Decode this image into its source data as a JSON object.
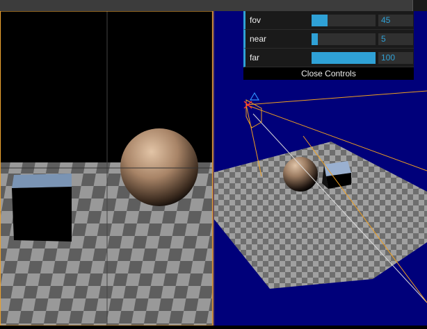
{
  "controls": {
    "sliders": [
      {
        "label": "fov",
        "value": "45",
        "fraction": 0.25
      },
      {
        "label": "near",
        "value": "5",
        "fraction": 0.1
      },
      {
        "label": "far",
        "value": "100",
        "fraction": 1.0
      }
    ],
    "close_label": "Close Controls",
    "accent_color": "#2fa1d6"
  },
  "colors": {
    "right_viewport_background": "#00007a",
    "frustum_line": "#f0a020",
    "checker_light": "#9a9a9a",
    "checker_dark": "#6a6a6a"
  }
}
